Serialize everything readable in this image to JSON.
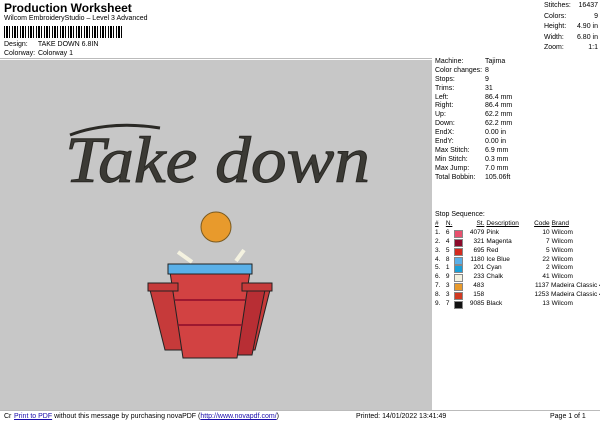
{
  "header": {
    "title": "Production Worksheet",
    "subtitle": "Wilcom EmbroideryStudio – Level 3 Advanced",
    "design_label": "Design:",
    "design_value": "TAKE DOWN 6.8IN",
    "colorway_label": "Colorway:",
    "colorway_value": "Colorway 1"
  },
  "top_stats": [
    {
      "label": "Stitches:",
      "value": "16437"
    },
    {
      "label": "Colors:",
      "value": "9"
    },
    {
      "label": "Height:",
      "value": "4.90 in"
    },
    {
      "label": "Width:",
      "value": "6.80 in"
    },
    {
      "label": "Zoom:",
      "value": "1:1"
    }
  ],
  "machine_info": [
    {
      "label": "Machine:",
      "value": "Tajima"
    },
    {
      "label": "Color changes:",
      "value": "8"
    },
    {
      "label": "Stops:",
      "value": "9"
    },
    {
      "label": "Trims:",
      "value": "31"
    },
    {
      "label": "Left:",
      "value": "86.4 mm"
    },
    {
      "label": "Right:",
      "value": "86.4 mm"
    },
    {
      "label": "Up:",
      "value": "62.2 mm"
    },
    {
      "label": "Down:",
      "value": "62.2 mm"
    },
    {
      "label": "EndX:",
      "value": "0.00 in"
    },
    {
      "label": "EndY:",
      "value": "0.00 in"
    },
    {
      "label": "Max Stitch:",
      "value": "6.9 mm"
    },
    {
      "label": "Min Stitch:",
      "value": "0.3 mm"
    },
    {
      "label": "Max Jump:",
      "value": "7.0 mm"
    },
    {
      "label": "Total Bobbin:",
      "value": "105.06ft"
    }
  ],
  "stop_sequence": {
    "title": "Stop Sequence:",
    "headers": [
      "#",
      "N.",
      "",
      "St.",
      "Description",
      "Code",
      "Brand"
    ],
    "rows": [
      {
        "n": "1.",
        "s": "6",
        "color": "#e8506e",
        "st": "4079",
        "desc": "Pink",
        "code": "10",
        "brand": "Wilcom"
      },
      {
        "n": "2.",
        "s": "4",
        "color": "#8b0a2a",
        "st": "321",
        "desc": "Magenta",
        "code": "7",
        "brand": "Wilcom"
      },
      {
        "n": "3.",
        "s": "5",
        "color": "#d42a1e",
        "st": "695",
        "desc": "Red",
        "code": "5",
        "brand": "Wilcom"
      },
      {
        "n": "4.",
        "s": "8",
        "color": "#5ab0e8",
        "st": "1180",
        "desc": "Ice Blue",
        "code": "22",
        "brand": "Wilcom"
      },
      {
        "n": "5.",
        "s": "1",
        "color": "#1aa0d8",
        "st": "201",
        "desc": "Cyan",
        "code": "2",
        "brand": "Wilcom"
      },
      {
        "n": "6.",
        "s": "9",
        "color": "#f4f2e0",
        "st": "233",
        "desc": "Chalk",
        "code": "41",
        "brand": "Wilcom"
      },
      {
        "n": "7.",
        "s": "3",
        "color": "#e89a2c",
        "st": "483",
        "desc": "",
        "code": "1137",
        "brand": "Madeira Classic 40"
      },
      {
        "n": "8.",
        "s": "3",
        "color": "#d03a22",
        "st": "158",
        "desc": "",
        "code": "1253",
        "brand": "Madeira Classic 40"
      },
      {
        "n": "9.",
        "s": "7",
        "color": "#111111",
        "st": "9085",
        "desc": "Black",
        "code": "13",
        "brand": "Wilcom"
      }
    ]
  },
  "design_text": "Take down",
  "footer": {
    "prefix": "Cr",
    "link1": "Print to PDF",
    "middle": " without this message by purchasing novaPDF (",
    "link2": "http://www.novapdf.com/",
    "suffix": ")",
    "printed": "Printed: 14/01/2022 13:41:49",
    "page": "Page 1 of 1"
  }
}
